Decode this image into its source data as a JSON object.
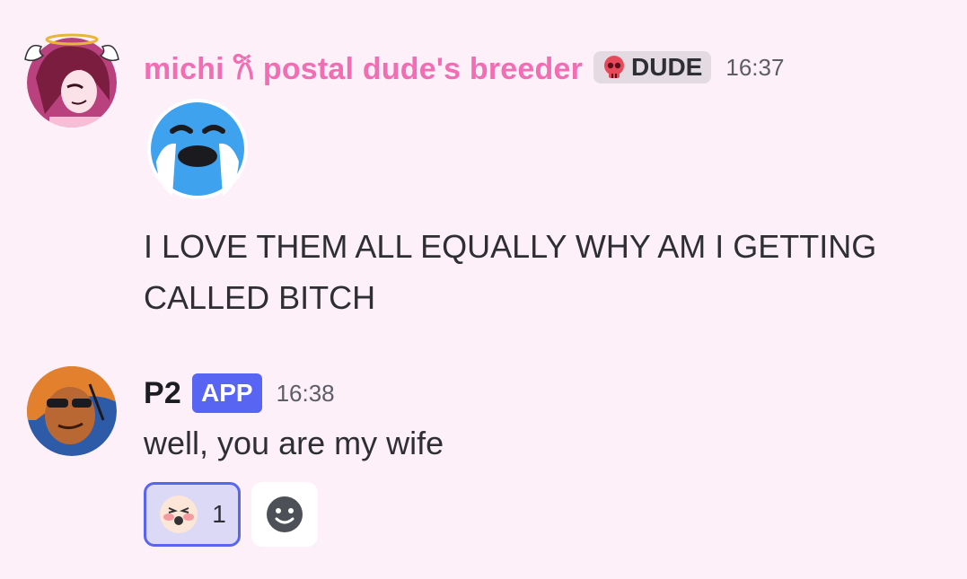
{
  "messages": [
    {
      "username": "michi 𐙚 postal dude's breeder",
      "tag": {
        "icon": "skull-icon",
        "label": "DUDE"
      },
      "timestamp": "16:37",
      "attachment_emoji": "loudly-crying-emoji",
      "text": "I LOVE THEM ALL EQUALLY WHY AM I GETTING CALLED BITCH"
    },
    {
      "username": "P2",
      "app_tag": "APP",
      "timestamp": "16:38",
      "text": "well, you are my wife",
      "reactions": [
        {
          "emoji": "blushing-shout-emoji",
          "count": "1",
          "active": true
        }
      ],
      "add_reaction_icon": "smiley-icon"
    }
  ],
  "colors": {
    "background": "#fdf0f8",
    "username1": "#f26db4",
    "app_tag": "#5865f2"
  }
}
